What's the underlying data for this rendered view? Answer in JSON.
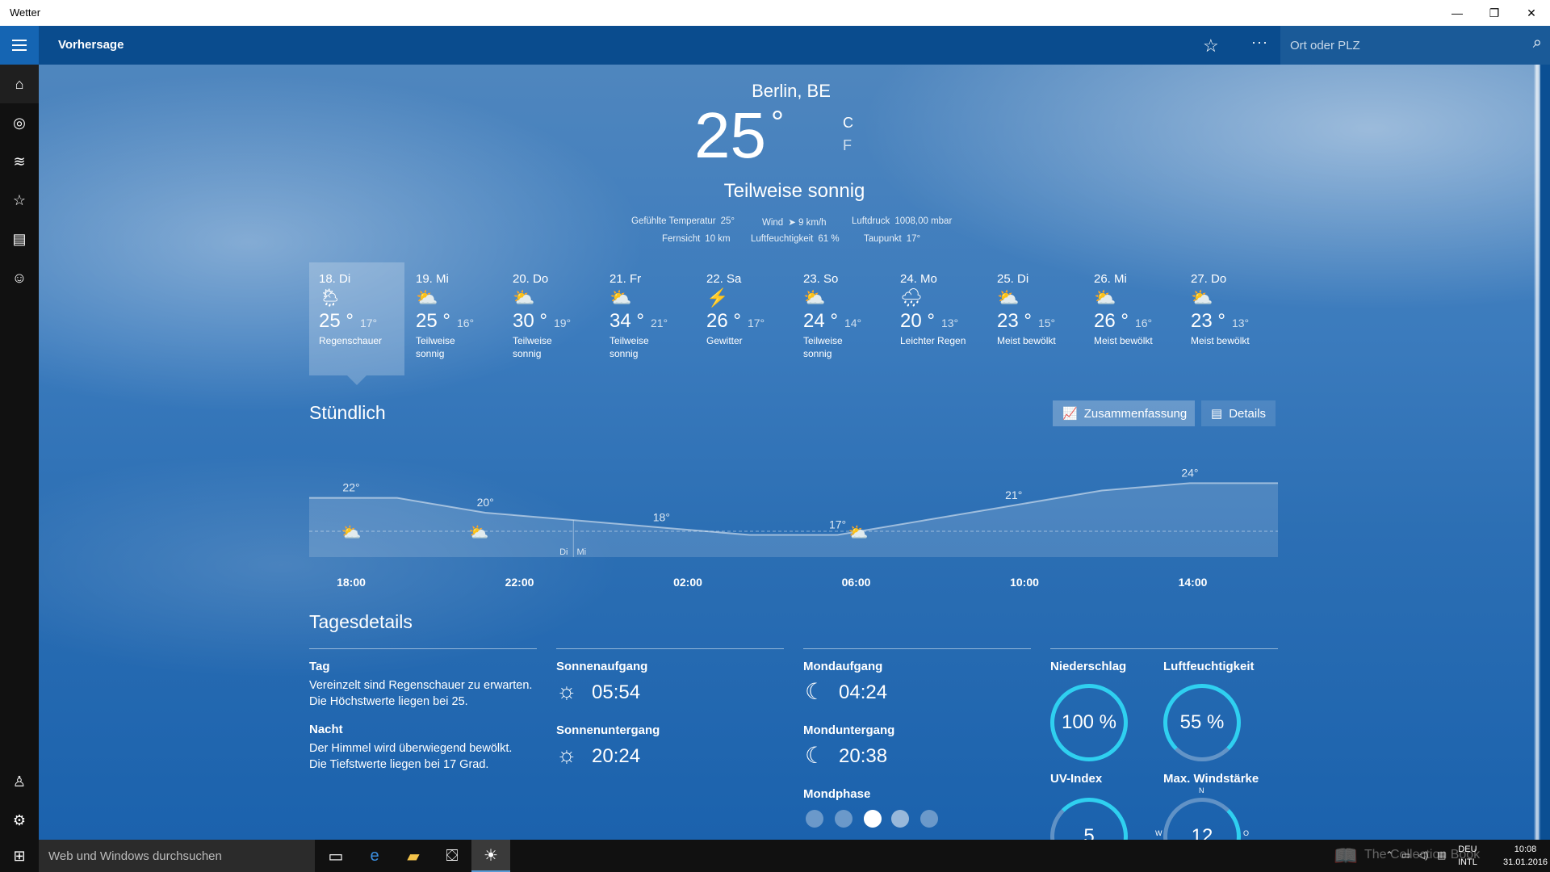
{
  "window": {
    "title": "Wetter",
    "minimize": "—",
    "restore": "❐",
    "close": "✕"
  },
  "appbar": {
    "title": "Vorhersage",
    "favorite_glyph": "☆",
    "more_glyph": "···",
    "search_placeholder": "Ort oder PLZ",
    "search_glyph": "⌕"
  },
  "rail": [
    {
      "name": "home-icon",
      "glyph": "⌂"
    },
    {
      "name": "radar-icon",
      "glyph": "◎"
    },
    {
      "name": "historical-icon",
      "glyph": "≋"
    },
    {
      "name": "favorites-icon",
      "glyph": "☆"
    },
    {
      "name": "news-icon",
      "glyph": "▤"
    },
    {
      "name": "feedback-icon",
      "glyph": "☺"
    }
  ],
  "rail_bottom": [
    {
      "name": "account-icon",
      "glyph": "♙"
    },
    {
      "name": "settings-icon",
      "glyph": "⚙"
    }
  ],
  "current": {
    "city": "Berlin, BE",
    "temp": "25",
    "deg": "°",
    "unit_c": "C",
    "unit_f": "F",
    "condition": "Teilweise sonnig",
    "feels_label": "Gefühlte Temperatur",
    "feels_value": "25°",
    "wind_label": "Wind",
    "wind_value": "➤ 9 km/h",
    "pressure_label": "Luftdruck",
    "pressure_value": "1008,00 mbar",
    "visibility_label": "Fernsicht",
    "visibility_value": "10 km",
    "humidity_label": "Luftfeuchtigkeit",
    "humidity_value": "61 %",
    "dewpoint_label": "Taupunkt",
    "dewpoint_value": "17°"
  },
  "days": [
    {
      "date": "18. Di",
      "icon": "🌦",
      "hi": "25 °",
      "lo": "17°",
      "desc": "Regenschauer"
    },
    {
      "date": "19. Mi",
      "icon": "⛅",
      "hi": "25 °",
      "lo": "16°",
      "desc": "Teilweise sonnig"
    },
    {
      "date": "20. Do",
      "icon": "⛅",
      "hi": "30 °",
      "lo": "19°",
      "desc": "Teilweise sonnig"
    },
    {
      "date": "21. Fr",
      "icon": "⛅",
      "hi": "34 °",
      "lo": "21°",
      "desc": "Teilweise sonnig"
    },
    {
      "date": "22. Sa",
      "icon": "⚡",
      "hi": "26 °",
      "lo": "17°",
      "desc": "Gewitter"
    },
    {
      "date": "23. So",
      "icon": "⛅",
      "hi": "24 °",
      "lo": "14°",
      "desc": "Teilweise sonnig"
    },
    {
      "date": "24. Mo",
      "icon": "🌧",
      "hi": "20 °",
      "lo": "13°",
      "desc": "Leichter Regen"
    },
    {
      "date": "25. Di",
      "icon": "⛅",
      "hi": "23 °",
      "lo": "15°",
      "desc": "Meist bewölkt"
    },
    {
      "date": "26. Mi",
      "icon": "⛅",
      "hi": "26 °",
      "lo": "16°",
      "desc": "Meist bewölkt"
    },
    {
      "date": "27. Do",
      "icon": "⛅",
      "hi": "23 °",
      "lo": "13°",
      "desc": "Meist bewölkt"
    }
  ],
  "hourly": {
    "title": "Stündlich",
    "summary_label": "Zusammenfassung",
    "details_label": "Details",
    "ticks": [
      "18:00",
      "22:00",
      "02:00",
      "06:00",
      "10:00",
      "14:00"
    ],
    "day_left": "Di",
    "day_right": "Mi",
    "temps": [
      22,
      22,
      20,
      19,
      18,
      17,
      17,
      19,
      21,
      23,
      24,
      24
    ],
    "labels": [
      {
        "i": 0,
        "text": "22°"
      },
      {
        "i": 2,
        "text": "20°"
      },
      {
        "i": 4,
        "text": "18°"
      },
      {
        "i": 6,
        "text": "17°"
      },
      {
        "i": 8,
        "text": "21°"
      },
      {
        "i": 10,
        "text": "24°"
      }
    ]
  },
  "chart_data": {
    "type": "area",
    "x": [
      "18:00",
      "20:00",
      "22:00",
      "00:00",
      "02:00",
      "04:00",
      "06:00",
      "08:00",
      "10:00",
      "12:00",
      "14:00",
      "16:00"
    ],
    "series": [
      {
        "values": [
          22,
          22,
          20,
          19,
          18,
          17,
          17,
          19,
          21,
          23,
          24,
          24
        ]
      }
    ],
    "ylim": [
      14,
      26
    ]
  },
  "tagesdetails": {
    "title": "Tagesdetails",
    "tag_label": "Tag",
    "tag_text1": "Vereinzelt sind Regenschauer zu erwarten.",
    "tag_text2": "Die Höchstwerte liegen bei 25.",
    "nacht_label": "Nacht",
    "nacht_text1": "Der Himmel wird überwiegend bewölkt.",
    "nacht_text2": "Die Tiefstwerte liegen bei 17 Grad.",
    "sunrise_label": "Sonnenaufgang",
    "sunrise": "05:54",
    "sunset_label": "Sonnenuntergang",
    "sunset": "20:24",
    "moonrise_label": "Mondaufgang",
    "moonrise": "04:24",
    "moonset_label": "Monduntergang",
    "moonset": "20:38",
    "moonphase_label": "Mondphase",
    "precip_label": "Niederschlag",
    "precip": "100 %",
    "humidity_label": "Luftfeuchtigkeit",
    "humidity": "55 %",
    "uv_label": "UV-Index",
    "uv": "5",
    "wind_label": "Max. Windstärke",
    "wind": "12",
    "compass_n": "N",
    "compass_w": "W",
    "compass_o": "O"
  },
  "taskbar": {
    "search_placeholder": "Web und Windows durchsuchen",
    "lang": "DEU",
    "layout": "INTL",
    "time": "10:08",
    "date": "31.01.2016",
    "watermark": "The Collection Book"
  },
  "colors": {
    "accent": "#0a4c8e",
    "gauge": "#2fd0f0",
    "rail": "#111111"
  }
}
